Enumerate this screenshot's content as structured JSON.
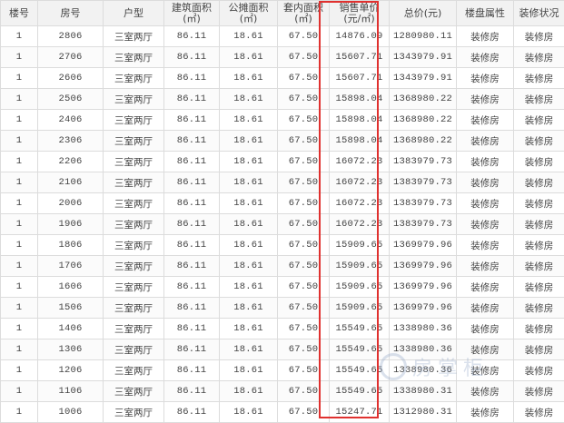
{
  "table": {
    "headers": {
      "building": "楼号",
      "room": "房号",
      "layout": "户型",
      "build_area": "建筑面积\n(㎡)",
      "shared_area": "公摊面积\n(㎡)",
      "inner_area": "套内面积\n(㎡)",
      "unit_price": "销售单价\n(元/㎡)",
      "total_price": "总价(元)",
      "property_attr": "楼盘属性",
      "decoration": "装修状况"
    },
    "rows": [
      {
        "building": "1",
        "room": "2806",
        "layout": "三室两厅",
        "build_area": "86.11",
        "shared_area": "18.61",
        "inner_area": "67.50",
        "unit_price": "14876.09",
        "total_price": "1280980.11",
        "property_attr": "装修房",
        "decoration": "装修房"
      },
      {
        "building": "1",
        "room": "2706",
        "layout": "三室两厅",
        "build_area": "86.11",
        "shared_area": "18.61",
        "inner_area": "67.50",
        "unit_price": "15607.71",
        "total_price": "1343979.91",
        "property_attr": "装修房",
        "decoration": "装修房"
      },
      {
        "building": "1",
        "room": "2606",
        "layout": "三室两厅",
        "build_area": "86.11",
        "shared_area": "18.61",
        "inner_area": "67.50",
        "unit_price": "15607.71",
        "total_price": "1343979.91",
        "property_attr": "装修房",
        "decoration": "装修房"
      },
      {
        "building": "1",
        "room": "2506",
        "layout": "三室两厅",
        "build_area": "86.11",
        "shared_area": "18.61",
        "inner_area": "67.50",
        "unit_price": "15898.04",
        "total_price": "1368980.22",
        "property_attr": "装修房",
        "decoration": "装修房"
      },
      {
        "building": "1",
        "room": "2406",
        "layout": "三室两厅",
        "build_area": "86.11",
        "shared_area": "18.61",
        "inner_area": "67.50",
        "unit_price": "15898.04",
        "total_price": "1368980.22",
        "property_attr": "装修房",
        "decoration": "装修房"
      },
      {
        "building": "1",
        "room": "2306",
        "layout": "三室两厅",
        "build_area": "86.11",
        "shared_area": "18.61",
        "inner_area": "67.50",
        "unit_price": "15898.04",
        "total_price": "1368980.22",
        "property_attr": "装修房",
        "decoration": "装修房"
      },
      {
        "building": "1",
        "room": "2206",
        "layout": "三室两厅",
        "build_area": "86.11",
        "shared_area": "18.61",
        "inner_area": "67.50",
        "unit_price": "16072.23",
        "total_price": "1383979.73",
        "property_attr": "装修房",
        "decoration": "装修房"
      },
      {
        "building": "1",
        "room": "2106",
        "layout": "三室两厅",
        "build_area": "86.11",
        "shared_area": "18.61",
        "inner_area": "67.50",
        "unit_price": "16072.23",
        "total_price": "1383979.73",
        "property_attr": "装修房",
        "decoration": "装修房"
      },
      {
        "building": "1",
        "room": "2006",
        "layout": "三室两厅",
        "build_area": "86.11",
        "shared_area": "18.61",
        "inner_area": "67.50",
        "unit_price": "16072.23",
        "total_price": "1383979.73",
        "property_attr": "装修房",
        "decoration": "装修房"
      },
      {
        "building": "1",
        "room": "1906",
        "layout": "三室两厅",
        "build_area": "86.11",
        "shared_area": "18.61",
        "inner_area": "67.50",
        "unit_price": "16072.23",
        "total_price": "1383979.73",
        "property_attr": "装修房",
        "decoration": "装修房"
      },
      {
        "building": "1",
        "room": "1806",
        "layout": "三室两厅",
        "build_area": "86.11",
        "shared_area": "18.61",
        "inner_area": "67.50",
        "unit_price": "15909.65",
        "total_price": "1369979.96",
        "property_attr": "装修房",
        "decoration": "装修房"
      },
      {
        "building": "1",
        "room": "1706",
        "layout": "三室两厅",
        "build_area": "86.11",
        "shared_area": "18.61",
        "inner_area": "67.50",
        "unit_price": "15909.65",
        "total_price": "1369979.96",
        "property_attr": "装修房",
        "decoration": "装修房"
      },
      {
        "building": "1",
        "room": "1606",
        "layout": "三室两厅",
        "build_area": "86.11",
        "shared_area": "18.61",
        "inner_area": "67.50",
        "unit_price": "15909.65",
        "total_price": "1369979.96",
        "property_attr": "装修房",
        "decoration": "装修房"
      },
      {
        "building": "1",
        "room": "1506",
        "layout": "三室两厅",
        "build_area": "86.11",
        "shared_area": "18.61",
        "inner_area": "67.50",
        "unit_price": "15909.65",
        "total_price": "1369979.96",
        "property_attr": "装修房",
        "decoration": "装修房"
      },
      {
        "building": "1",
        "room": "1406",
        "layout": "三室两厅",
        "build_area": "86.11",
        "shared_area": "18.61",
        "inner_area": "67.50",
        "unit_price": "15549.65",
        "total_price": "1338980.36",
        "property_attr": "装修房",
        "decoration": "装修房"
      },
      {
        "building": "1",
        "room": "1306",
        "layout": "三室两厅",
        "build_area": "86.11",
        "shared_area": "18.61",
        "inner_area": "67.50",
        "unit_price": "15549.65",
        "total_price": "1338980.36",
        "property_attr": "装修房",
        "decoration": "装修房"
      },
      {
        "building": "1",
        "room": "1206",
        "layout": "三室两厅",
        "build_area": "86.11",
        "shared_area": "18.61",
        "inner_area": "67.50",
        "unit_price": "15549.65",
        "total_price": "1338980.36",
        "property_attr": "装修房",
        "decoration": "装修房"
      },
      {
        "building": "1",
        "room": "1106",
        "layout": "三室两厅",
        "build_area": "86.11",
        "shared_area": "18.61",
        "inner_area": "67.50",
        "unit_price": "15549.65",
        "total_price": "1338980.31",
        "property_attr": "装修房",
        "decoration": "装修房"
      },
      {
        "building": "1",
        "room": "1006",
        "layout": "三室两厅",
        "build_area": "86.11",
        "shared_area": "18.61",
        "inner_area": "67.50",
        "unit_price": "15247.71",
        "total_price": "1312980.31",
        "property_attr": "装修房",
        "decoration": "装修房"
      }
    ]
  },
  "highlight": {
    "column": "unit_price",
    "color": "#e0312f"
  },
  "watermark": {
    "text": "房掌柜"
  }
}
